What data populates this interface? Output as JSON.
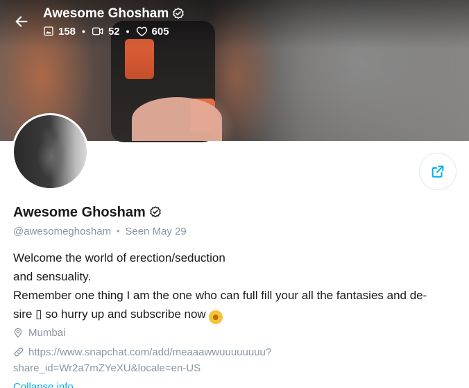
{
  "header": {
    "name": "Awesome Ghosham",
    "photos_count": "158",
    "videos_count": "52",
    "likes_count": "605"
  },
  "profile": {
    "name": "Awesome Ghosham",
    "username": "@awesomeghosham",
    "seen_label": "Seen",
    "seen_date": "May 29",
    "bio_lines": [
      "Welcome the world of erection/seduction",
      "and sensuality.",
      "Remember one thing I am the one who can full fill your all the fantasies and de-",
      "sire ▯ so hurry up and subscribe now"
    ],
    "location": "Mumbai",
    "link_line1": "https://www.snapchat.com/add/meaaawwuuuuuuuu?",
    "link_line2": "share_id=Wr2a7mZYeXU&locale=en-US",
    "collapse_label": "Collapse info"
  },
  "colors": {
    "accent": "#00aff0",
    "muted": "#8a96a3",
    "text": "#1a1a1a"
  },
  "icons": {
    "back": "arrow-left-icon",
    "verified": "verified-badge-icon",
    "photos": "image-icon",
    "videos": "video-icon",
    "likes": "heart-icon",
    "share": "share-icon",
    "location": "map-pin-icon",
    "link": "link-icon",
    "emoji": "smiling-face-icon"
  }
}
